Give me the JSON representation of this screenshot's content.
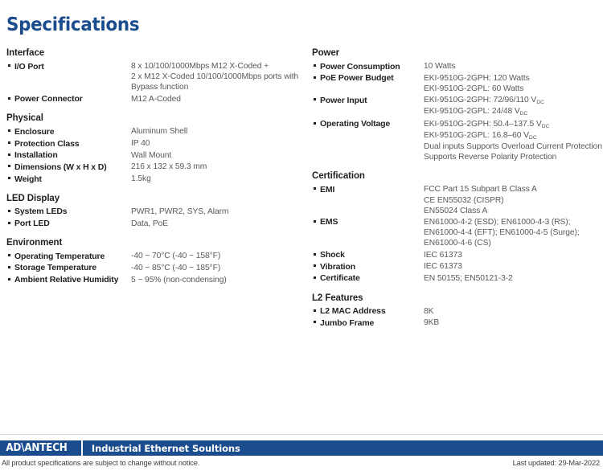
{
  "title": "Specifications",
  "colors": {
    "brand_blue": "#1b4d8e",
    "text_dark": "#231f20",
    "text_value": "#58595b"
  },
  "left_column": [
    {
      "heading": "Interface",
      "rows": [
        {
          "label": "I/O Port",
          "values": [
            "8 x 10/100/1000Mbps M12 X-Coded +",
            "2 x M12 X-Coded 10/100/1000Mbps ports with",
            "Bypass function"
          ]
        },
        {
          "label": "Power Connector",
          "values": [
            "M12 A-Coded"
          ]
        }
      ]
    },
    {
      "heading": "Physical",
      "rows": [
        {
          "label": "Enclosure",
          "values": [
            "Aluminum Shell"
          ]
        },
        {
          "label": "Protection Class",
          "values": [
            "IP 40"
          ]
        },
        {
          "label": "Installation",
          "values": [
            "Wall Mount"
          ]
        },
        {
          "label": "Dimensions (W x H x D)",
          "values": [
            "216 x 132 x 59.3 mm"
          ]
        },
        {
          "label": "Weight",
          "values": [
            "1.5kg"
          ]
        }
      ]
    },
    {
      "heading": "LED Display",
      "rows": [
        {
          "label": "System LEDs",
          "values": [
            "PWR1, PWR2, SYS, Alarm"
          ]
        },
        {
          "label": "Port LED",
          "values": [
            "Data, PoE"
          ]
        }
      ]
    },
    {
      "heading": "Environment",
      "wide": true,
      "rows": [
        {
          "label": "Operating Temperature",
          "values": [
            "-40 ~ 70°C (-40 ~ 158°F)"
          ]
        },
        {
          "label": "Storage Temperature",
          "values": [
            "-40 ~ 85°C (-40 ~ 185°F)"
          ]
        },
        {
          "label": "Ambient Relative Humidity",
          "values": [
            "5 ~ 95% (non-condensing)"
          ]
        }
      ]
    }
  ],
  "right_column": [
    {
      "heading": "Power",
      "rows": [
        {
          "label": "Power Consumption",
          "values": [
            "10 Watts"
          ]
        },
        {
          "label": "PoE Power Budget",
          "values": [
            "EKI-9510G-2GPH:  120 Watts",
            "EKI-9510G-2GPL: 60 Watts"
          ]
        },
        {
          "label": "Power Input",
          "values_html": [
            "EKI-9510G-2GPH: 72/96/110 V<sub>DC</sub>",
            "EKI-9510G-2GPL: 24/48 V<sub>DC</sub>"
          ]
        },
        {
          "label": "Operating Voltage",
          "values_html": [
            "EKI-9510G-2GPH: 50.4–137.5 V<sub>DC</sub>",
            "EKI-9510G-2GPL: 16.8–60 V<sub>DC</sub>",
            "Dual inputs Supports Overload Current Protection",
            "Supports Reverse Polarity Protection"
          ]
        }
      ]
    },
    {
      "heading": "Certification",
      "rows": [
        {
          "label": "EMI",
          "values": [
            "FCC Part 15 Subpart B Class A",
            "CE EN55032 (CISPR)",
            "EN55024 Class A"
          ]
        },
        {
          "label": "EMS",
          "values": [
            "EN61000-4-2 (ESD); EN61000-4-3 (RS);",
            "EN61000-4-4 (EFT); EN61000-4-5 (Surge);",
            "EN61000-4-6 (CS)"
          ]
        },
        {
          "label": "Shock",
          "values": [
            "IEC 61373"
          ]
        },
        {
          "label": "Vibration",
          "values": [
            "IEC 61373"
          ]
        },
        {
          "label": "Certificate",
          "values": [
            "EN 50155; EN50121-3-2"
          ]
        }
      ]
    },
    {
      "heading": "L2 Features",
      "rows": [
        {
          "label": "L2 MAC Address",
          "values": [
            "8K"
          ]
        },
        {
          "label": "Jumbo Frame",
          "values": [
            "9KB"
          ]
        }
      ]
    }
  ],
  "footer": {
    "brand": "AD\\ANTECH",
    "tagline": "Industrial Ethernet Soultions",
    "disclaimer": "All product specifications are subject to change without notice.",
    "last_updated": "Last updated: 29-Mar-2022"
  }
}
